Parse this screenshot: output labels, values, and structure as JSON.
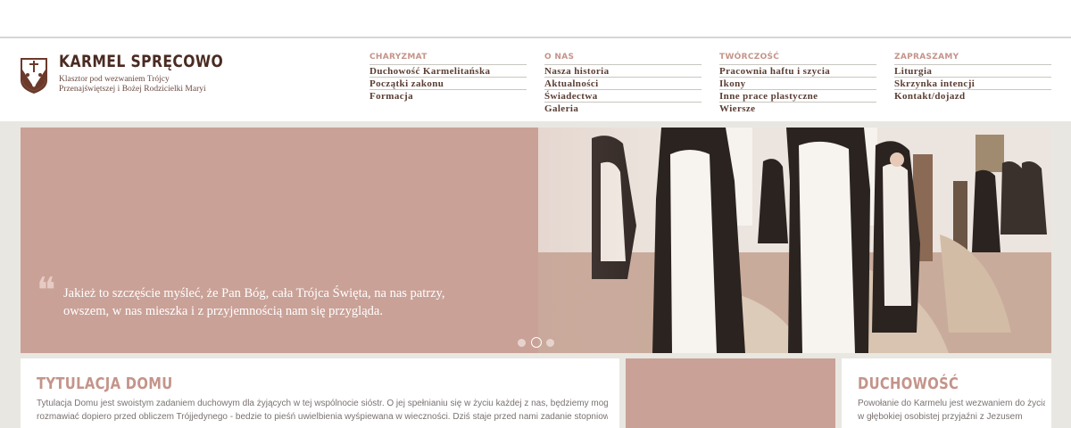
{
  "brand": {
    "title": "KARMEL SPRĘCOWO",
    "subtitle_line1": "Klasztor pod wezwaniem Trójcy",
    "subtitle_line2": "Przenajświętszej i Bożej Rodzicielki Maryi"
  },
  "nav": [
    {
      "heading": "CHARYZMAT",
      "items": [
        "Duchowość Karmelitańska",
        "Początki zakonu",
        "Formacja"
      ]
    },
    {
      "heading": "O NAS",
      "items": [
        "Nasza historia",
        "Aktualności",
        "Świadectwa",
        "Galeria"
      ]
    },
    {
      "heading": "TWÓRCZOŚĆ",
      "items": [
        "Pracownia haftu i szycia",
        "Ikony",
        "Inne prace plastyczne",
        "Wiersze"
      ]
    },
    {
      "heading": "ZAPRASZAMY",
      "items": [
        "Liturgia",
        "Skrzynka intencji",
        "Kontakt/dojazd"
      ]
    }
  ],
  "hero": {
    "quote_line1": "Jakież to szczęście myśleć, że Pan Bóg, cała Trójca Święta, na nas patrzy,",
    "quote_line2": "owszem, w nas mieszka i z przyjemnością nam się przygląda.",
    "slide_count": 3,
    "active_slide": 2
  },
  "cards": {
    "left": {
      "title": "TYTULACJA DOMU",
      "line1": "Tytulacja Domu jest swoistym zadaniem duchowym dla żyjących w tej wspólnocie sióstr. O jej spełnianiu się w życiu każdej z nas, będziemy mogły",
      "line2": "rozmawiać dopiero przed obliczem Trójjedynego - bedzie to pieśń uwielbienia wyśpiewana w wieczności. Dziś staje przed nami zadanie stopniowego"
    },
    "right": {
      "title": "DUCHOWOŚĆ",
      "line1": "Powołanie do Karmelu jest wezwaniem do życia",
      "line2": "w głębokiej osobistej przyjaźni z Jezusem"
    }
  },
  "colors": {
    "accent": "#c4948a",
    "brand_dark": "#4a2b22",
    "hero_bg": "#c9a197"
  }
}
